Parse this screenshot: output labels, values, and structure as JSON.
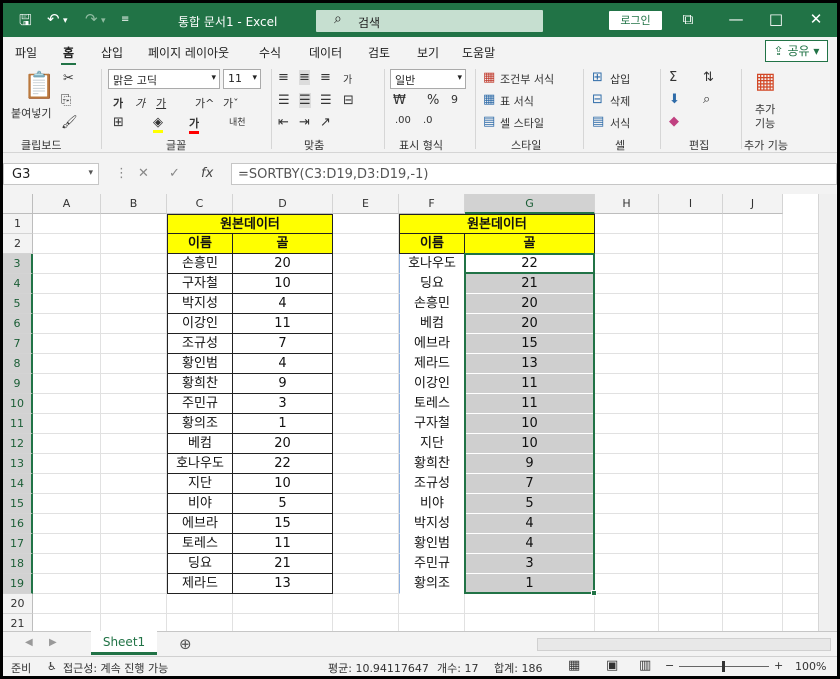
{
  "titlebar": {
    "title": "통합 문서1  -  Excel",
    "search": "검색",
    "login": "로그인"
  },
  "menu": {
    "items": [
      "파일",
      "홈",
      "삽입",
      "페이지 레이아웃",
      "수식",
      "데이터",
      "검토",
      "보기",
      "도움말"
    ],
    "active": "홈",
    "share": "공유"
  },
  "ribbon": {
    "clipboard": {
      "label": "클립보드",
      "paste": "붙여넣기"
    },
    "font": {
      "label": "글꼴",
      "name": "맑은 고딕",
      "size": "11",
      "bold": "가",
      "italic": "가",
      "underline": "가",
      "grow": "가^",
      "shrink": "가ˇ",
      "phonetic": "내천"
    },
    "align": {
      "label": "맞춤",
      "wrap": "가"
    },
    "number": {
      "label": "표시 형식",
      "format": "일반"
    },
    "style": {
      "label": "스타일",
      "cond": "조건부 서식",
      "table": "표 서식",
      "cell": "셀 스타일"
    },
    "cells": {
      "label": "셀",
      "insert": "삽입",
      "delete": "삭제",
      "format": "서식"
    },
    "edit": {
      "label": "편집"
    },
    "addin": {
      "label": "추가 기능",
      "btn1": "추가",
      "btn2": "기능"
    }
  },
  "formulabar": {
    "namebox": "G3",
    "fx": "fx",
    "formula": "=SORTBY(C3:D19,D3:D19,-1)"
  },
  "columns": [
    "A",
    "B",
    "C",
    "D",
    "E",
    "F",
    "G",
    "H",
    "I",
    "J"
  ],
  "rows": [
    "1",
    "2",
    "3",
    "4",
    "5",
    "6",
    "7",
    "8",
    "9",
    "10",
    "11",
    "12",
    "13",
    "14",
    "15",
    "16",
    "17",
    "18",
    "19",
    "20",
    "21"
  ],
  "source_table": {
    "title": "원본데이터",
    "headers": [
      "이름",
      "골"
    ],
    "rows": [
      [
        "손흥민",
        "20"
      ],
      [
        "구자철",
        "10"
      ],
      [
        "박지성",
        "4"
      ],
      [
        "이강인",
        "11"
      ],
      [
        "조규성",
        "7"
      ],
      [
        "황인범",
        "4"
      ],
      [
        "황희찬",
        "9"
      ],
      [
        "주민규",
        "3"
      ],
      [
        "황의조",
        "1"
      ],
      [
        "베컴",
        "20"
      ],
      [
        "호나우도",
        "22"
      ],
      [
        "지단",
        "10"
      ],
      [
        "비야",
        "5"
      ],
      [
        "에브라",
        "15"
      ],
      [
        "토레스",
        "11"
      ],
      [
        "딩요",
        "21"
      ],
      [
        "제라드",
        "13"
      ]
    ]
  },
  "sorted_table": {
    "title": "원본데이터",
    "headers": [
      "이름",
      "골"
    ],
    "rows": [
      [
        "호나우도",
        "22"
      ],
      [
        "딩요",
        "21"
      ],
      [
        "손흥민",
        "20"
      ],
      [
        "베컴",
        "20"
      ],
      [
        "에브라",
        "15"
      ],
      [
        "제라드",
        "13"
      ],
      [
        "이강인",
        "11"
      ],
      [
        "토레스",
        "11"
      ],
      [
        "구자철",
        "10"
      ],
      [
        "지단",
        "10"
      ],
      [
        "황희찬",
        "9"
      ],
      [
        "조규성",
        "7"
      ],
      [
        "비야",
        "5"
      ],
      [
        "박지성",
        "4"
      ],
      [
        "황인범",
        "4"
      ],
      [
        "주민규",
        "3"
      ],
      [
        "황의조",
        "1"
      ]
    ]
  },
  "tabs": {
    "sheet": "Sheet1",
    "add": "⊕"
  },
  "status": {
    "ready": "준비",
    "access": "접근성: 계속 진행 가능",
    "avg": "평균: 10.94117647",
    "count": "개수: 17",
    "sum": "합계: 186",
    "zoom": "100%"
  },
  "colors": {
    "accent": "#217346",
    "header_fill": "#ffff00",
    "spill_fill": "#cfcfcf"
  }
}
